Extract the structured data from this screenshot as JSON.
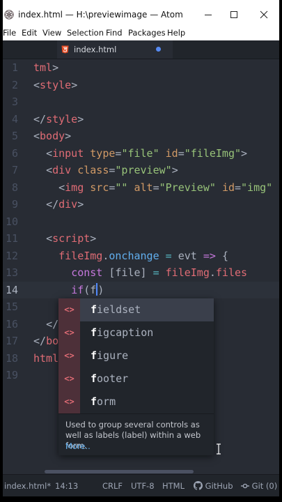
{
  "window": {
    "title": "index.html — H:\\previewimage — Atom",
    "minimize_glyph": "—",
    "maximize_glyph": "☐",
    "close_glyph": "✕"
  },
  "menu": [
    "File",
    "Edit",
    "View",
    "Selection",
    "Find",
    "Packages",
    "Help"
  ],
  "tab": {
    "label": "index.html",
    "modified": true
  },
  "editor": {
    "cursor_line": 14
  },
  "autocomplete": {
    "items": [
      {
        "match": "f",
        "rest": "ieldset",
        "badge": "<>"
      },
      {
        "match": "f",
        "rest": "igcaption",
        "badge": "<>"
      },
      {
        "match": "f",
        "rest": "igure",
        "badge": "<>"
      },
      {
        "match": "f",
        "rest": "ooter",
        "badge": "<>"
      },
      {
        "match": "f",
        "rest": "orm",
        "badge": "<>"
      }
    ],
    "description": "Used to group several controls as well as labels (label) within a web form.",
    "more_label": "More.."
  },
  "status": {
    "file": "index.html*",
    "position": "14:13",
    "line_ending": "CRLF",
    "encoding": "UTF-8",
    "grammar": "HTML",
    "github": "GitHub",
    "git": "Git (0)"
  },
  "colors": {
    "editor_bg": "#282c34",
    "tag": "#e06c75",
    "attr": "#d19a66",
    "string": "#98c379",
    "function": "#61afef",
    "keyword": "#c678dd",
    "accent": "#568af2"
  },
  "icons": {
    "app": "atom-logo-icon",
    "tab": "html5-file-icon",
    "github": "github-icon",
    "git": "git-commit-icon"
  }
}
